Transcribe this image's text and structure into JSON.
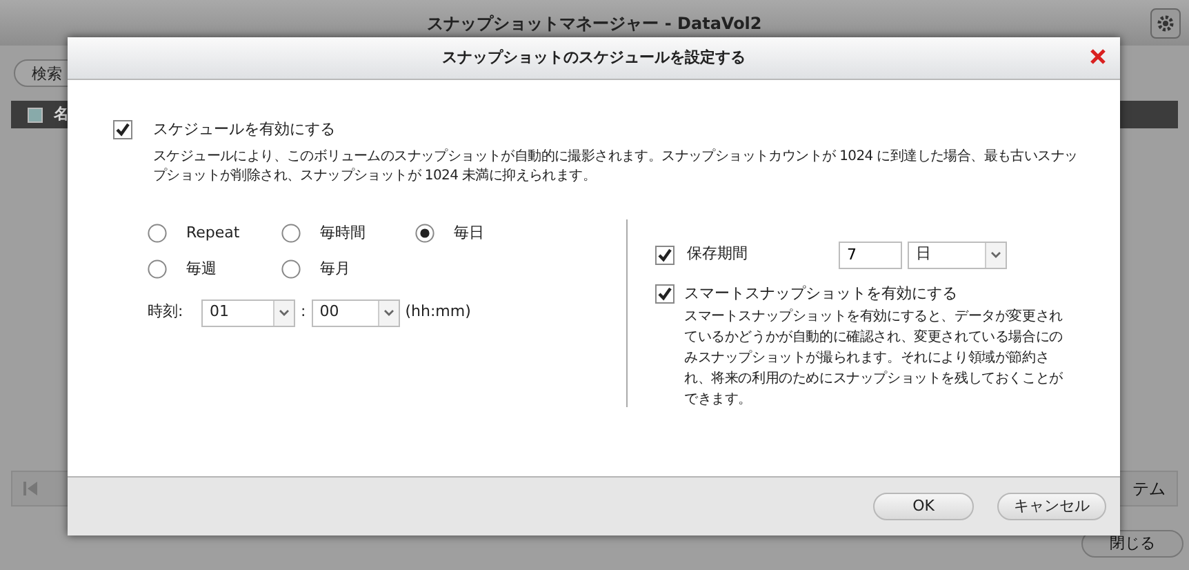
{
  "background_window": {
    "title": "スナップショットマネージャー - DataVol2",
    "search": {
      "placeholder": "検索"
    },
    "select_all_checked": false,
    "table_header": "名",
    "pager_text": "テム",
    "close_button": "閉じる"
  },
  "dialog": {
    "title": "スナップショットのスケジュールを設定する",
    "enable_schedule": {
      "label": "スケジュールを有効にする",
      "checked": true
    },
    "description": "スケジュールにより、このボリュームのスナップショットが自動的に撮影されます。スナップショットカウントが 1024 に到達した場合、最も古いスナップショットが削除され、スナップショットが 1024 未満に抑えられます。",
    "frequency": [
      {
        "label": "Repeat",
        "selected": false
      },
      {
        "label": "毎時間",
        "selected": false
      },
      {
        "label": "毎日",
        "selected": true
      },
      {
        "label": "毎週",
        "selected": false
      },
      {
        "label": "毎月",
        "selected": false
      }
    ],
    "time": {
      "label": "時刻:",
      "hour": "01",
      "separator": ":",
      "minute": "00",
      "format": "(hh:mm)"
    },
    "retention": {
      "label": "保存期間",
      "checked": true,
      "value": "7",
      "unit": "日"
    },
    "smart_snapshot": {
      "label": "スマートスナップショットを有効にする",
      "checked": true,
      "description": "スマートスナップショットを有効にすると、データが変更されているかどうかが自動的に確認され、変更されている場合にのみスナップショットが撮られます。それにより領域が節約され、将来の利用のためにスナップショットを残しておくことができます。"
    },
    "buttons": [
      "OK",
      "キャンセル"
    ]
  }
}
